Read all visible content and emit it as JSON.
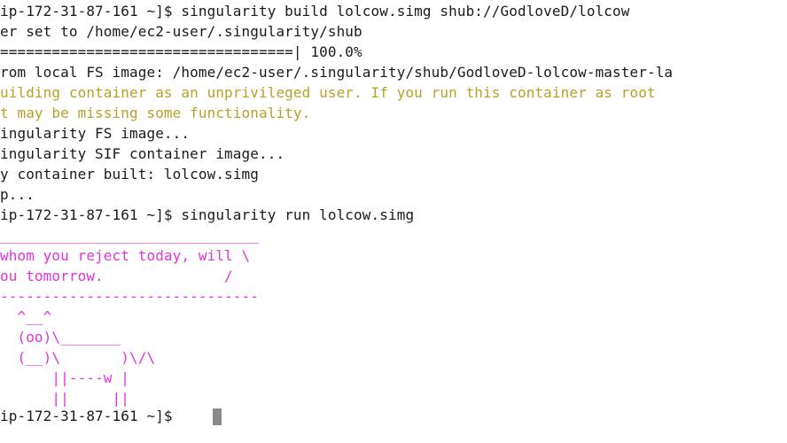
{
  "terminal": {
    "lines": [
      "ip-172-31-87-161 ~]$ singularity build lolcow.simg shub://GodloveD/lolcow",
      "er set to /home/ec2-user/.singularity/shub",
      "==================================| 100.0%",
      "rom local FS image: /home/ec2-user/.singularity/shub/GodloveD-lolcow-master-la",
      "uilding container as an unprivileged user. If you run this container as root",
      "t may be missing some functionality.",
      "ingularity FS image...",
      "ingularity SIF container image...",
      "y container built: lolcow.simg",
      "p...",
      "ip-172-31-87-161 ~]$ singularity run lolcow.simg",
      "______________________________",
      "whom you reject today, will \\",
      "ou tomorrow.              /",
      "------------------------------",
      "  ^__^",
      "  (oo)\\_______",
      "  (__)\\       )\\/\\",
      "      ||----w |",
      "      ||     ||",
      "ip-172-31-87-161 ~]$ "
    ],
    "colors": {
      "text": "#1a1a1a",
      "warning": "#b5a227",
      "cowsay": "#e333dc",
      "cursor": "#8a8a8a",
      "background": "#ffffff"
    }
  }
}
